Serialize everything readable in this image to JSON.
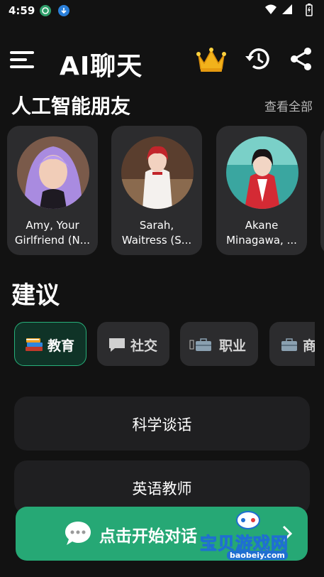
{
  "status_bar": {
    "time": "4:59"
  },
  "app_bar": {
    "title": "AI聊天"
  },
  "friends_section": {
    "title": "人工智能朋友",
    "see_all": "查看全部",
    "cards": [
      {
        "name_line1": "Amy, Your",
        "name_line2": "Girlfriend (N..."
      },
      {
        "name_line1": "Sarah,",
        "name_line2": "Waitress (S..."
      },
      {
        "name_line1": "Akane",
        "name_line2": "Minagawa, ..."
      }
    ]
  },
  "suggestions_section": {
    "title": "建议",
    "categories": [
      {
        "label": "教育",
        "icon": "books-icon",
        "active": true
      },
      {
        "label": "社交",
        "icon": "chat-bubble-icon",
        "active": false
      },
      {
        "label": "职业",
        "icon": "briefcase-icon",
        "active": false
      },
      {
        "label": "商",
        "icon": "briefcase-icon",
        "active": false
      }
    ],
    "items": [
      {
        "label": "科学谈话"
      },
      {
        "label": "英语教师"
      }
    ]
  },
  "start_button": {
    "label": "点击开始对话"
  },
  "watermark": {
    "text": "宝贝游戏网",
    "url": "baobeiy.com"
  },
  "colors": {
    "background": "#121212",
    "card": "#2c2c2e",
    "accent": "#26a875",
    "active_chip_border": "#27b07a"
  }
}
